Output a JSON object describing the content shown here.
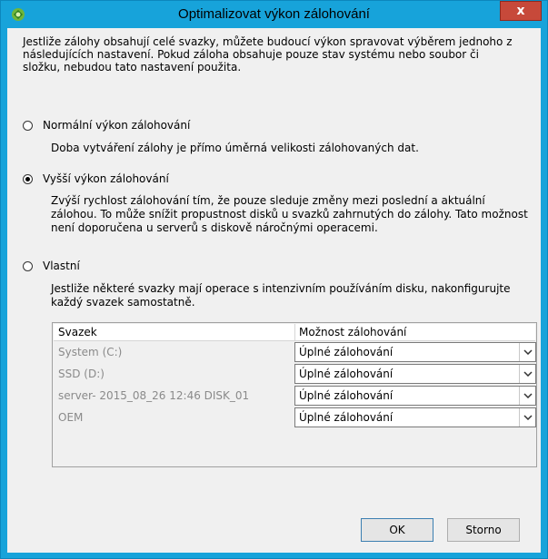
{
  "window": {
    "title": "Optimalizovat výkon zálohování",
    "close_label": "x"
  },
  "intro": "Jestliže zálohy obsahují celé svazky, můžete budoucí výkon spravovat výběrem jednoho z následujících nastavení. Pokud záloha obsahuje pouze stav systému nebo soubor či složku, nebudou tato nastavení použita.",
  "options": [
    {
      "label": "Normální výkon zálohování",
      "description": "Doba vytváření zálohy je přímo úměrná velikosti zálohovaných dat.",
      "checked": false
    },
    {
      "label": "Vyšší výkon zálohování",
      "description": "Zvýší rychlost zálohování tím, že pouze sleduje změny mezi poslední a aktuální zálohou. To může snížit propustnost disků u svazků zahrnutých do zálohy. Tato možnost není doporučena u serverů s diskově náročnými operacemi.",
      "checked": true
    },
    {
      "label": "Vlastní",
      "description": "Jestliže některé svazky mají operace s intenzivním používáním disku, nakonfigurujte každý svazek samostatně.",
      "checked": false
    }
  ],
  "table": {
    "headers": [
      "Svazek",
      "Možnost zálohování"
    ],
    "rows": [
      {
        "volume": "System (C:)",
        "option": "Úplné zálohování"
      },
      {
        "volume": "SSD (D:)",
        "option": "Úplné zálohování"
      },
      {
        "volume": "server- 2015_08_26 12:46 DISK_01",
        "option": "Úplné zálohování"
      },
      {
        "volume": "OEM",
        "option": "Úplné zálohování"
      }
    ]
  },
  "buttons": {
    "ok": "OK",
    "cancel": "Storno"
  },
  "colors": {
    "titlebar": "#17a3da",
    "close": "#c7493a"
  },
  "icons": {
    "app": "backup-app-icon",
    "close": "close-icon",
    "dropdown": "chevron-down-icon"
  }
}
